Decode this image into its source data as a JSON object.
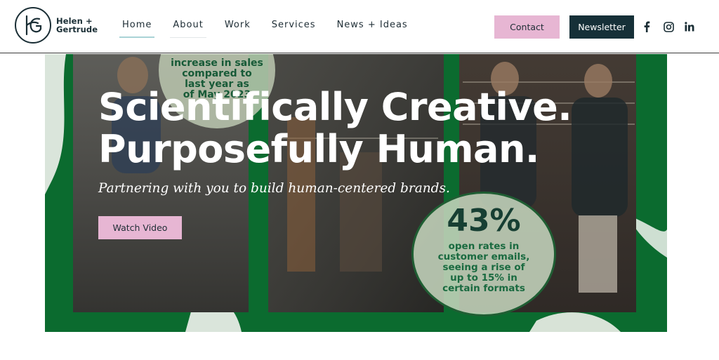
{
  "brand": {
    "logo_line1": "Helen +",
    "logo_line2": "Gertrude"
  },
  "nav": {
    "items": [
      {
        "label": "Home",
        "active": true
      },
      {
        "label": "About"
      },
      {
        "label": "Work"
      },
      {
        "label": "Services"
      },
      {
        "label": "News + Ideas"
      }
    ],
    "contact_label": "Contact",
    "newsletter_label": "Newsletter"
  },
  "social": {
    "icons": [
      "facebook-icon",
      "instagram-icon",
      "linkedin-icon"
    ]
  },
  "hero": {
    "title_line1": "Scientifically Creative.",
    "title_line2": "Purposefully Human.",
    "subtitle": "Partnering with you to build human-centered brands.",
    "cta_label": "Watch Video",
    "stat_top_lines": [
      "increase in sales",
      "compared to",
      "last year as",
      "of May 2023"
    ],
    "stat_big": "43%",
    "stat_lines": [
      "open rates in",
      "customer emails,",
      "seeing a rise of",
      "up to 15% in",
      "certain formats"
    ]
  },
  "colors": {
    "hero_green": "#0b6b2f",
    "accent_pink": "#e7b6d3",
    "dark_teal": "#163038",
    "nav_underline": "#a9d3d6"
  }
}
